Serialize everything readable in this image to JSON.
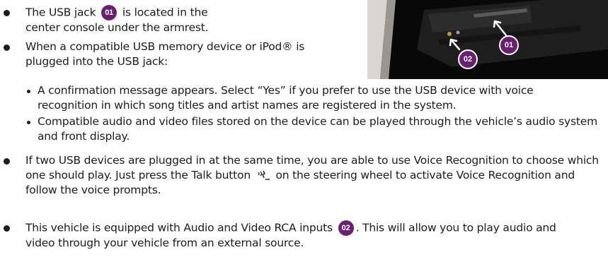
{
  "callouts": {
    "c01": "01",
    "c02": "02"
  },
  "bullets": {
    "b1": {
      "text1": "The USB jack",
      "text2": "is located in the center console under the armrest."
    },
    "b2": {
      "text": "When a compatible USB memory device or iPod® is plugged into the USB jack:",
      "sub1": "A confirmation message appears. Select “Yes” if you prefer to use the USB device with voice recognition in which song titles and artist names are registered in the system.",
      "sub2": "Compatible audio and video files stored on the device can be played through the vehicle’s audio system and front display."
    },
    "b3": {
      "text1": "If two USB devices are plugged in at the same time, you are able to use Voice Recognition to choose which one should play. Just press the Talk button",
      "text2": "on the steering wheel to activate Voice Recognition and follow the voice prompts."
    },
    "b4": {
      "text1": "This vehicle is equipped with Audio and Video RCA inputs",
      "text2": ". This will allow you to play audio and video through your vehicle from an external source."
    }
  },
  "icons": {
    "talk": "voice-talk-icon",
    "photo": "usb-console-photo"
  },
  "colors": {
    "badge": "#6a1f70",
    "text": "#1c1c1c",
    "photo_bg": "#0a0a0a"
  }
}
